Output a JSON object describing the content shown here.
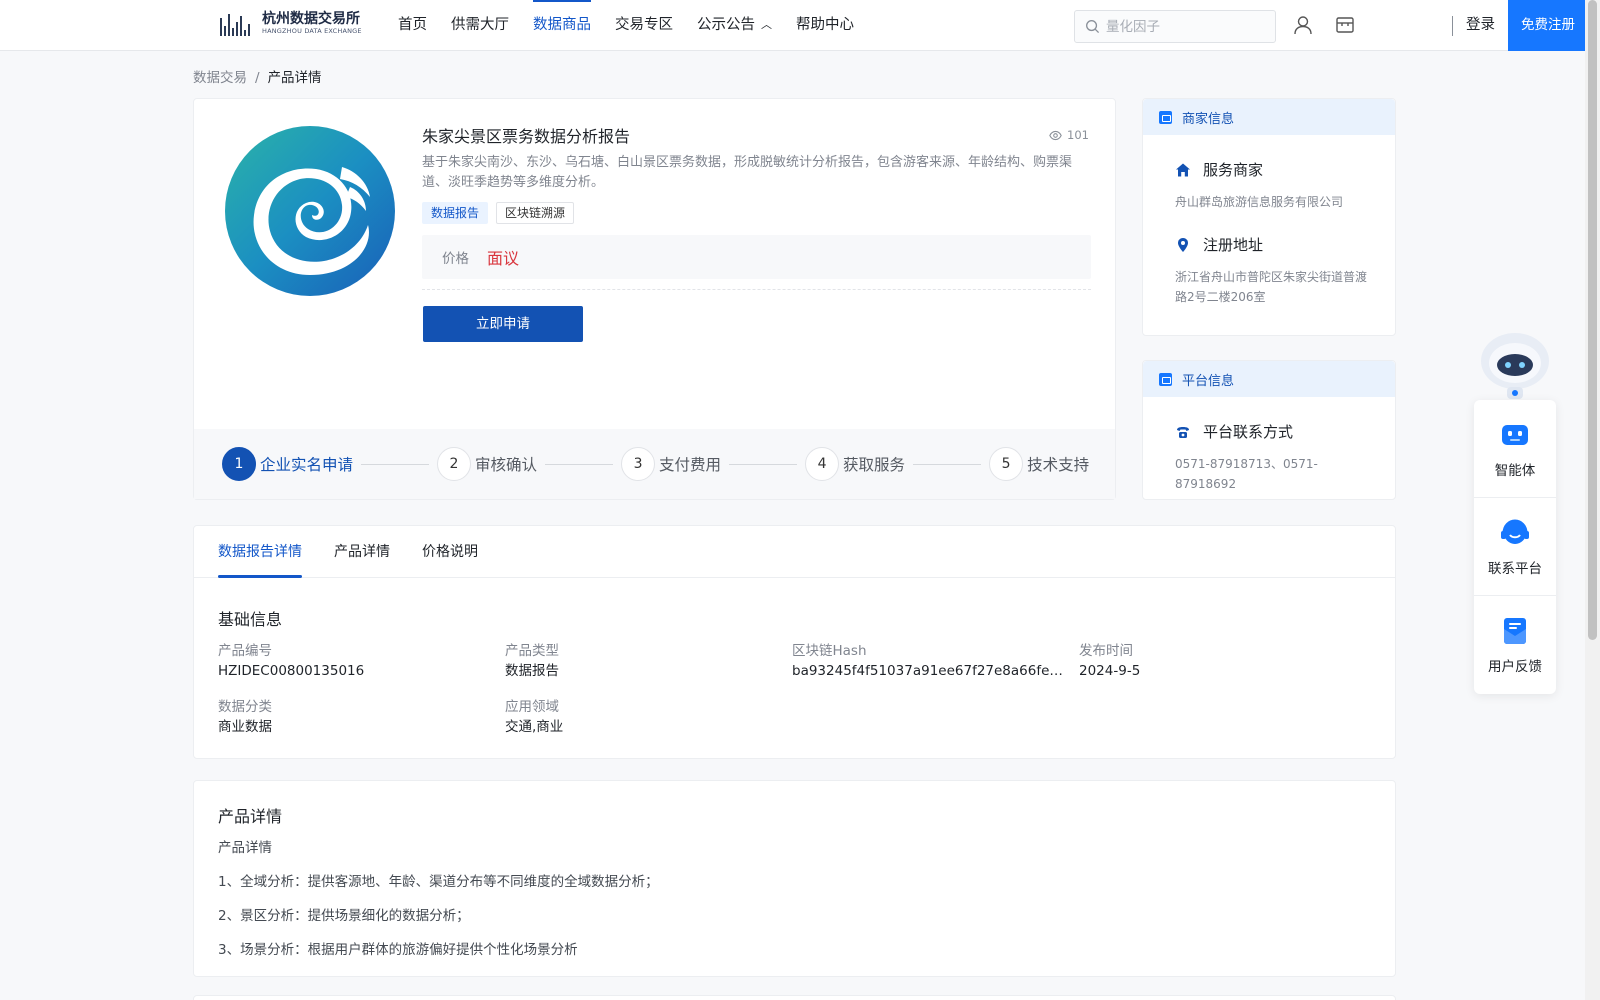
{
  "header": {
    "logo_cn": "杭州数据交易所",
    "logo_en": "HANGZHOU DATA EXCHANGE",
    "nav": [
      {
        "label": "首页"
      },
      {
        "label": "供需大厅"
      },
      {
        "label": "数据商品"
      },
      {
        "label": "交易专区"
      },
      {
        "label": "公示公告"
      },
      {
        "label": "帮助中心"
      }
    ],
    "active_nav_index": 2,
    "search_placeholder": "量化因子",
    "login_label": "登录",
    "register_label": "免费注册"
  },
  "breadcrumb": {
    "parent": "数据交易",
    "separator": "/",
    "current": "产品详情"
  },
  "product": {
    "title": "朱家尖景区票务数据分析报告",
    "views": "101",
    "description": "基于朱家尖南沙、东沙、乌石塘、白山景区票务数据，形成脱敏统计分析报告，包含游客来源、年龄结构、购票渠道、淡旺季趋势等多维度分析。",
    "tags": [
      "数据报告",
      "区块链溯源"
    ],
    "price_label": "价格",
    "price_value": "面议",
    "apply_label": "立即申请",
    "steps": [
      {
        "num": "1",
        "label": "企业实名申请"
      },
      {
        "num": "2",
        "label": "审核确认"
      },
      {
        "num": "3",
        "label": "支付费用"
      },
      {
        "num": "4",
        "label": "获取服务"
      },
      {
        "num": "5",
        "label": "技术支持"
      }
    ],
    "active_step_index": 0
  },
  "merchant": {
    "header": "商家信息",
    "service_title": "服务商家",
    "service_value": "舟山群岛旅游信息服务有限公司",
    "address_title": "注册地址",
    "address_value": "浙江省舟山市普陀区朱家尖街道普渡路2号二楼206室"
  },
  "platform": {
    "header": "平台信息",
    "contact_title": "平台联系方式",
    "contact_value": "0571-87918713、0571-87918692"
  },
  "tabs": {
    "items": [
      {
        "label": "数据报告详情"
      },
      {
        "label": "产品详情"
      },
      {
        "label": "价格说明"
      }
    ],
    "active_index": 0
  },
  "basic_info": {
    "title": "基础信息",
    "fields": [
      {
        "label": "产品编号",
        "value": "HZIDEC00800135016"
      },
      {
        "label": "产品类型",
        "value": "数据报告"
      },
      {
        "label": "区块链Hash",
        "value": "ba93245f4f51037a91ee67f27e8a66fe338…"
      },
      {
        "label": "发布时间",
        "value": "2024-9-5"
      },
      {
        "label": "数据分类",
        "value": "商业数据"
      },
      {
        "label": "应用领域",
        "value": "交通,商业"
      }
    ]
  },
  "detail": {
    "title": "产品详情",
    "lines": [
      "产品详情",
      "1、全域分析：提供客源地、年龄、渠道分布等不同维度的全域数据分析；",
      "2、景区分析：提供场景细化的数据分析；",
      "3、场景分析：根据用户群体的旅游偏好提供个性化场景分析"
    ]
  },
  "float_panel": {
    "items": [
      {
        "label": "智能体"
      },
      {
        "label": "联系平台"
      },
      {
        "label": "用户反馈"
      }
    ]
  },
  "colors": {
    "primary": "#1352b3",
    "nav_active": "#1357c9",
    "register_bg": "#1677ff",
    "price": "#d9363e",
    "side_head_bg": "#e9f2fd"
  },
  "icons": [
    "search-icon",
    "user-icon",
    "store-icon",
    "eye-icon",
    "home-icon",
    "location-pin-icon",
    "phone-icon",
    "robot-avatar-icon",
    "agent-icon",
    "headset-icon",
    "feedback-icon"
  ]
}
